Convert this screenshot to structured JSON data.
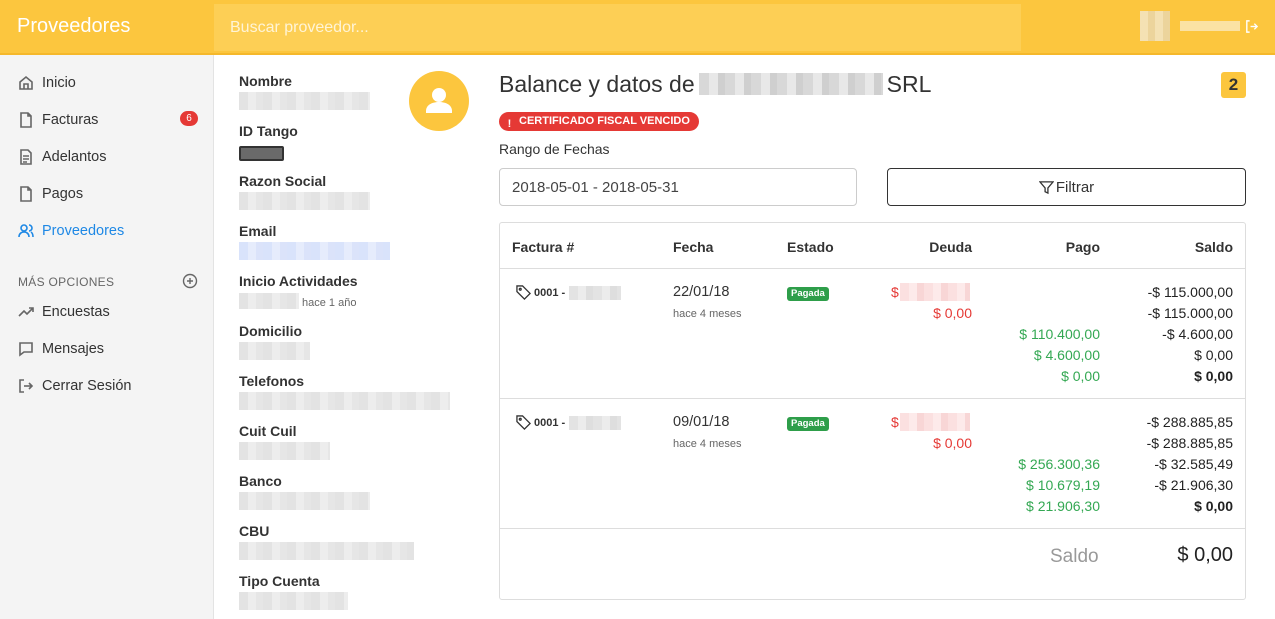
{
  "app": {
    "title": "Proveedores"
  },
  "search": {
    "placeholder": "Buscar proveedor..."
  },
  "sidebar": {
    "items": [
      {
        "label": "Inicio"
      },
      {
        "label": "Facturas",
        "badge": "6"
      },
      {
        "label": "Adelantos"
      },
      {
        "label": "Pagos"
      },
      {
        "label": "Proveedores"
      }
    ],
    "section_title": "MÁS OPCIONES",
    "extra": [
      {
        "label": "Encuestas"
      },
      {
        "label": "Mensajes"
      },
      {
        "label": "Cerrar Sesión"
      }
    ]
  },
  "details": {
    "labels": [
      "Nombre",
      "ID Tango",
      "Razon Social",
      "Email",
      "Inicio Actividades",
      "Domicilio",
      "Telefonos",
      "Cuit Cuil",
      "Banco",
      "CBU",
      "Tipo Cuenta"
    ],
    "inicio_since": "hace 1 año"
  },
  "main": {
    "title_prefix": "Balance y datos de",
    "title_suffix": "SRL",
    "count": "2",
    "warning": "CERTIFICADO FISCAL VENCIDO",
    "range_label": "Rango de Fechas",
    "range_value": "2018-05-01 - 2018-05-31",
    "filter_label": "Filtrar"
  },
  "table": {
    "headers": {
      "factura": "Factura #",
      "fecha": "Fecha",
      "estado": "Estado",
      "deuda": "Deuda",
      "pago": "Pago",
      "saldo": "Saldo"
    },
    "rows": [
      {
        "factura_prefix": "0001 -",
        "fecha": "22/01/18",
        "fecha_rel": "hace 4 meses",
        "estado": "Pagada",
        "deuda": [
          "$",
          "$ 0,00"
        ],
        "pagos": [
          "$ 110.400,00",
          "$ 4.600,00",
          "$ 0,00"
        ],
        "saldos": [
          "-$ 115.000,00",
          "-$ 115.000,00",
          "-$ 4.600,00",
          "$ 0,00",
          "$ 0,00"
        ]
      },
      {
        "factura_prefix": "0001 -",
        "fecha": "09/01/18",
        "fecha_rel": "hace 4 meses",
        "estado": "Pagada",
        "deuda": [
          "$",
          "$ 0,00"
        ],
        "pagos": [
          "$ 256.300,36",
          "$ 10.679,19",
          "$ 21.906,30"
        ],
        "saldos": [
          "-$ 288.885,85",
          "-$ 288.885,85",
          "-$ 32.585,49",
          "-$ 21.906,30",
          "$ 0,00"
        ]
      }
    ],
    "saldo_label": "Saldo",
    "saldo_total": "$ 0,00"
  }
}
